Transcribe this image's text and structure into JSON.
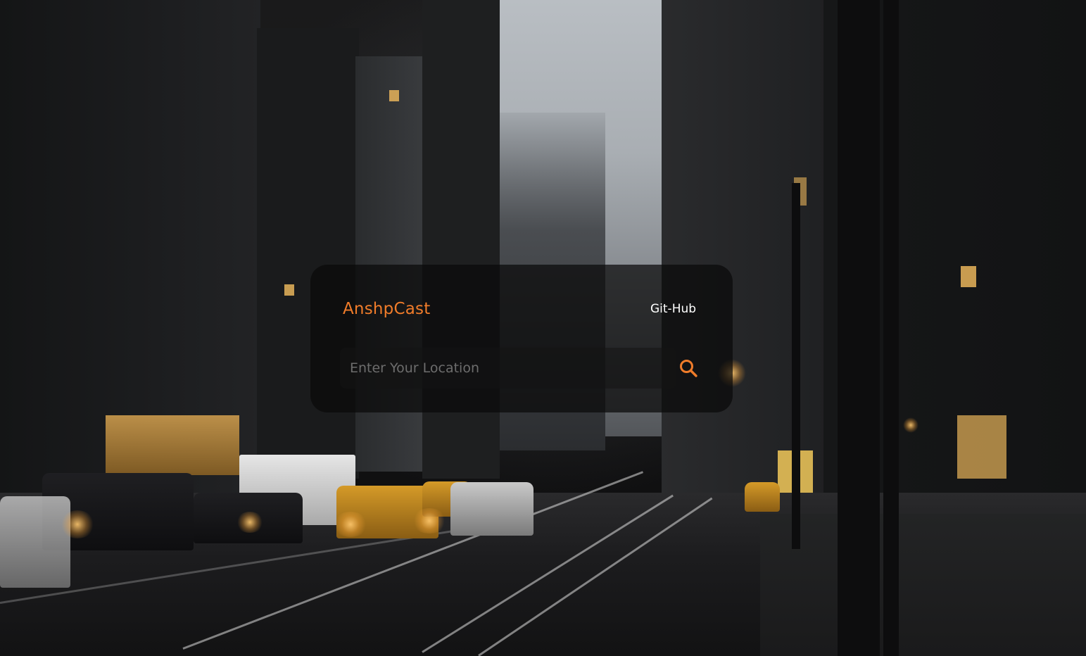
{
  "app": {
    "brand": "AnshpCast"
  },
  "nav": {
    "github_label": "Git-Hub"
  },
  "search": {
    "value": "",
    "placeholder": "Enter Your Location",
    "icon": "search-icon"
  },
  "colors": {
    "accent": "#f07c2a",
    "card_background": "rgba(10,10,10,0.72)",
    "text": "#ffffff",
    "placeholder": "#6d6d6d"
  }
}
